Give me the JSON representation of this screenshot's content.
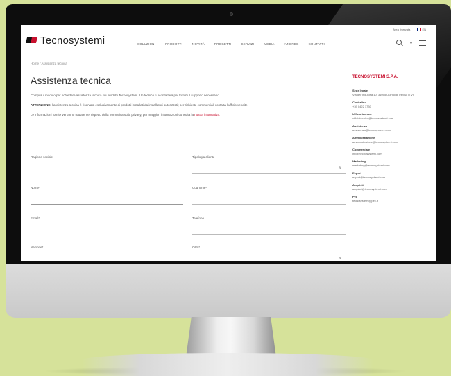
{
  "header": {
    "logo": "Tecnosystemi",
    "nav": [
      "Soluzioni",
      "Prodotti",
      "Novità",
      "Progetti",
      "Servizi",
      "Media",
      "Aziende",
      "Contatti"
    ]
  },
  "topbar": {
    "area_riservata": "Area riservata",
    "lang": "EN"
  },
  "breadcrumb": "Home / Assistenza tecnica",
  "page": {
    "title": "Assistenza tecnica",
    "para1": "Compila il modulo per richiedere assistenza tecnica sui prodotti Tecnosystemi. Un tecnico ti ricontatterà per fornirti il supporto necessario.",
    "para2_bold": "ATTENZIONE:",
    "para2": "l'assistenza tecnica è riservata esclusivamente ai prodotti installati da installatori autorizzati; per richieste commerciali contatta l'ufficio vendite.",
    "para3": "Le informazioni fornite verranno trattate nel rispetto della normativa sulla privacy, per maggiori informazioni consulta la",
    "para3_link": "nostra informativa."
  },
  "form": {
    "labels": {
      "ragione_sociale": "Ragione sociale",
      "tipo_cliente": "Tipologia cliente",
      "nome": "Nome*",
      "cognome": "Cognome*",
      "email": "Email*",
      "telefono": "Telefono",
      "nazione": "Nazione*",
      "citta": "Città*"
    }
  },
  "sidebar": {
    "title": "Tecnosystemi S.p.A.",
    "address": {
      "label": "Sede legale",
      "value": "Via dell'Industria 10, 31055 Quinto di Treviso (TV)"
    },
    "blocks": [
      {
        "h": "Centralino",
        "v": "+39 0422 1730"
      },
      {
        "h": "Ufficio tecnico",
        "v": "ufficiotecnico@tecnosystemi.com"
      },
      {
        "h": "Assistenza",
        "v": "assistenza@tecnosystemi.com"
      },
      {
        "h": "Amministrazione",
        "v": "amministrazione@tecnosystemi.com"
      },
      {
        "h": "Commerciale",
        "v": "info@tecnosystemi.com"
      },
      {
        "h": "Marketing",
        "v": "marketing@tecnosystemi.com"
      },
      {
        "h": "Export",
        "v": "export@tecnosystemi.com"
      },
      {
        "h": "Acquisti",
        "v": "acquisti@tecnosystemi.com"
      },
      {
        "h": "Pec",
        "v": "tecnosystemi@pec.it"
      }
    ]
  }
}
